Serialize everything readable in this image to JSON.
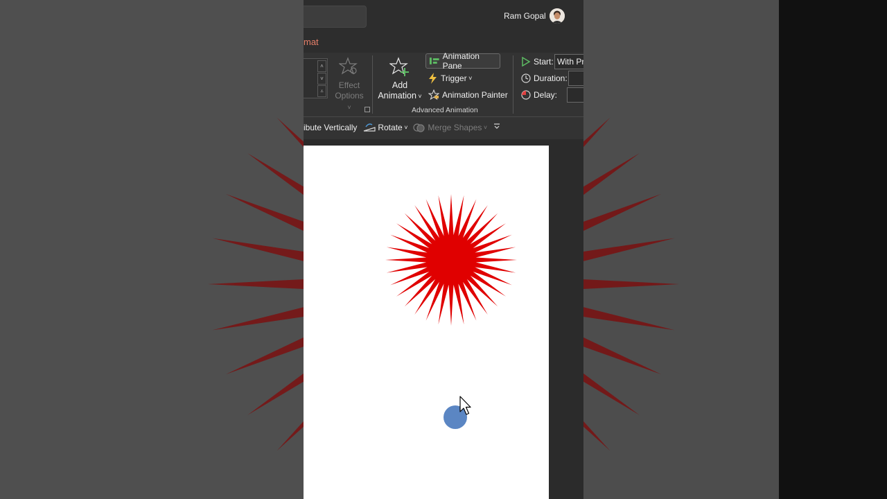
{
  "account": {
    "user_name": "Ram Gopal"
  },
  "tabs": {
    "active_tab_partial": "mat"
  },
  "ribbon": {
    "effect_options": {
      "line1": "Effect",
      "line2": "Options"
    },
    "add_animation": {
      "line1": "Add",
      "line2": "Animation"
    },
    "animation_pane": "Animation Pane",
    "trigger": "Trigger",
    "animation_painter": "Animation Painter",
    "group_advanced": "Advanced Animation",
    "timing": {
      "start_label": "Start:",
      "start_value": "With Pre",
      "duration_label": "Duration:",
      "delay_label": "Delay:"
    }
  },
  "arrange_bar": {
    "distribute_partial": "ibute Vertically",
    "rotate": "Rotate",
    "merge_shapes": "Merge Shapes"
  },
  "slide": {
    "shapes": [
      {
        "name": "starburst",
        "color": "#e00000"
      },
      {
        "name": "circle",
        "color": "#5b86c3"
      }
    ]
  },
  "colors": {
    "accent_tab": "#e6806a",
    "ribbon_bg": "#333333",
    "titlebar_bg": "#2d2d2d",
    "green_icon": "#5dbb63",
    "trigger_icon": "#f0c040"
  }
}
